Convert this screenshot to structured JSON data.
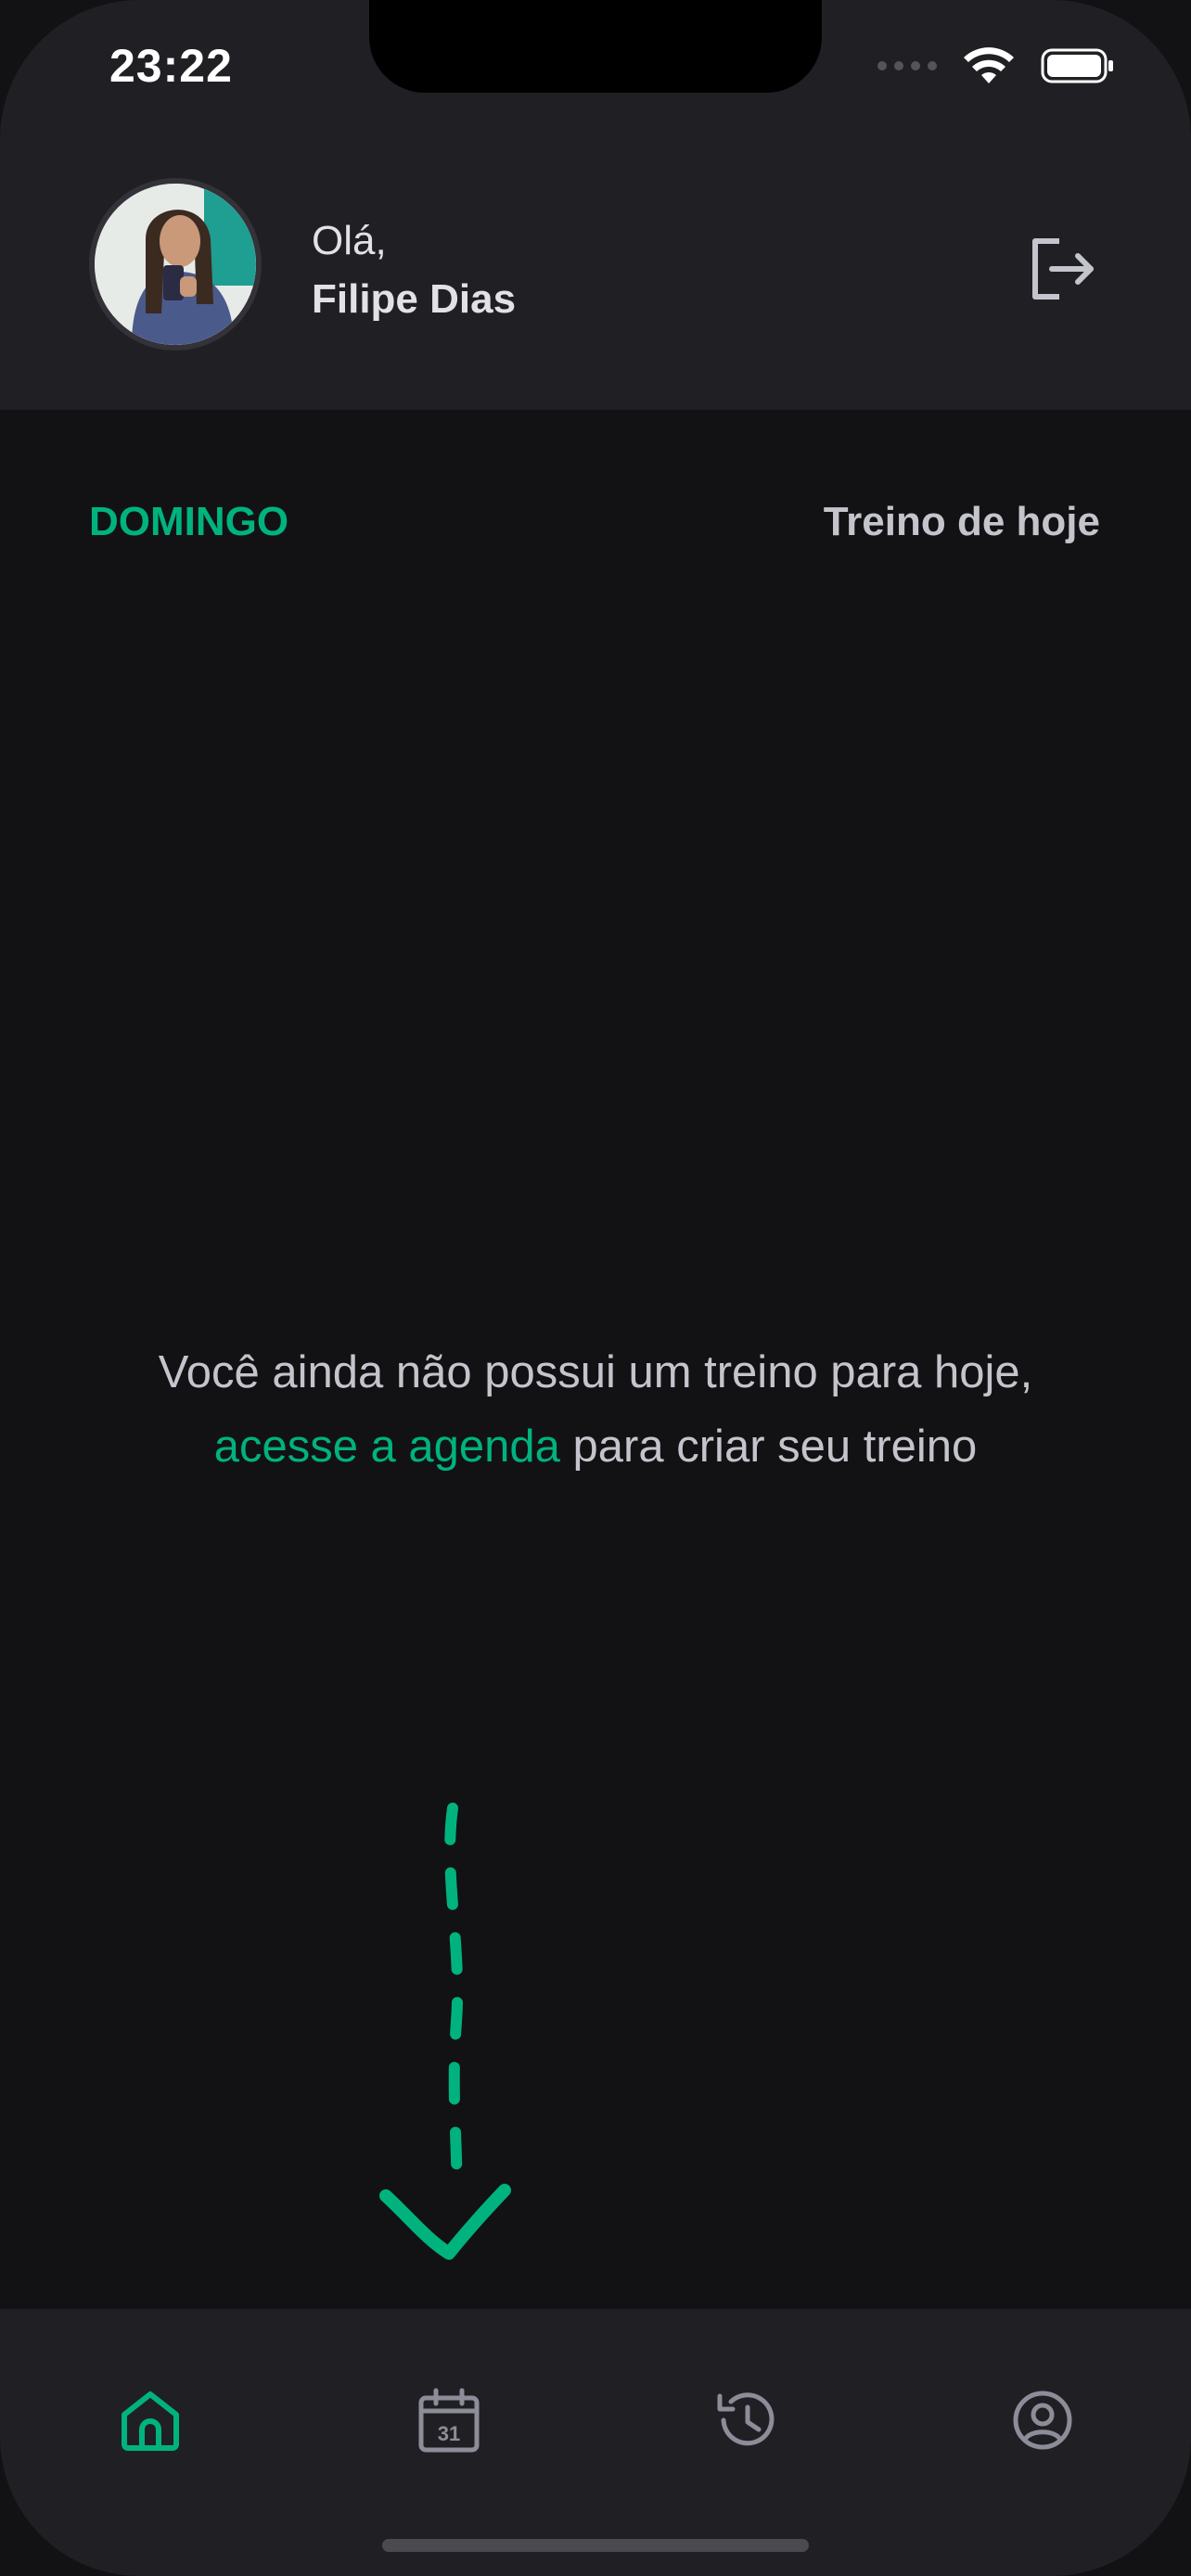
{
  "status_bar": {
    "time": "23:22"
  },
  "header": {
    "greeting": "Olá,",
    "user_name": "Filipe Dias"
  },
  "schedule": {
    "day": "DOMINGO",
    "section_title": "Treino de hoje"
  },
  "empty_state": {
    "line1": "Você ainda não possui um treino para hoje,",
    "link": "acesse a agenda",
    "line2_rest": " para criar seu treino"
  },
  "tabs": [
    {
      "icon": "home-icon",
      "active": true
    },
    {
      "icon": "calendar-icon",
      "label": "31",
      "active": false
    },
    {
      "icon": "history-icon",
      "active": false
    },
    {
      "icon": "profile-icon",
      "active": false
    }
  ],
  "colors": {
    "accent": "#00B37E",
    "background": "#121214",
    "surface": "#202024",
    "text": "#C4C4CC",
    "muted_icon": "#8D8D99"
  }
}
